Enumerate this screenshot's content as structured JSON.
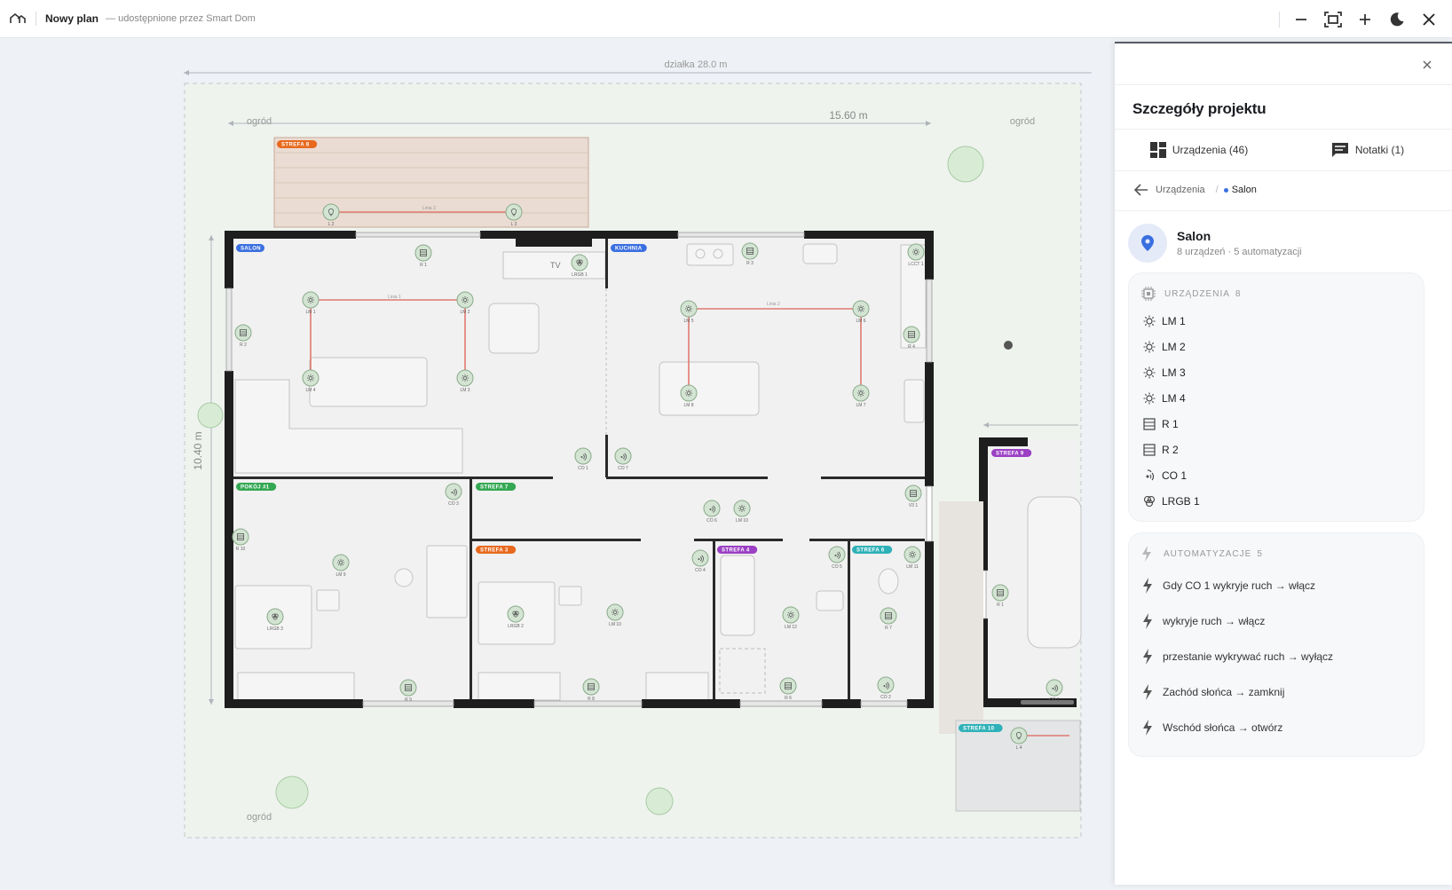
{
  "topbar": {
    "title": "Nowy plan",
    "subtitle": "— udostępnione przez Smart Dom"
  },
  "plan": {
    "plot_label": "działka 28.0 m",
    "width_label": "15.60 m",
    "height_label": "10.40 m",
    "garden_labels": [
      "ogród",
      "ogród",
      "ogród"
    ],
    "tv_label": "TV",
    "zones": [
      {
        "label": "STREFA 8",
        "color": "#e8691e"
      },
      {
        "label": "SALON",
        "color": "#3a6fe0"
      },
      {
        "label": "KUCHNIA",
        "color": "#3a6fe0"
      },
      {
        "label": "POKÓJ #1",
        "color": "#34a853"
      },
      {
        "label": "STREFA 7",
        "color": "#34a853"
      },
      {
        "label": "STREFA 3",
        "color": "#e8691e"
      },
      {
        "label": "STREFA 4",
        "color": "#9b3fc4"
      },
      {
        "label": "STREFA 6",
        "color": "#2eb1b8"
      },
      {
        "label": "STREFA 9",
        "color": "#9b3fc4"
      },
      {
        "label": "STREFA 10",
        "color": "#2eb1b8"
      }
    ],
    "devices": [
      {
        "id": "L 2",
        "icon": "bulb"
      },
      {
        "id": "L 3",
        "icon": "bulb"
      },
      {
        "id": "R 1",
        "icon": "shutter"
      },
      {
        "id": "LRGB 1",
        "icon": "rgb"
      },
      {
        "id": "LM 1",
        "icon": "light"
      },
      {
        "id": "LM 2",
        "icon": "light"
      },
      {
        "id": "LM 4",
        "icon": "light"
      },
      {
        "id": "LM 3",
        "icon": "light"
      },
      {
        "id": "R 2",
        "icon": "shutter"
      },
      {
        "id": "CO 1",
        "icon": "motion"
      },
      {
        "id": "CO 7",
        "icon": "motion"
      },
      {
        "id": "R 3",
        "icon": "shutter"
      },
      {
        "id": "LCCT 1",
        "icon": "light"
      },
      {
        "id": "LM 5",
        "icon": "light"
      },
      {
        "id": "LM 6",
        "icon": "light"
      },
      {
        "id": "LM 8",
        "icon": "light"
      },
      {
        "id": "LM 7",
        "icon": "light"
      },
      {
        "id": "R 4",
        "icon": "shutter"
      },
      {
        "id": "CO 3",
        "icon": "motion"
      },
      {
        "id": "R 10",
        "icon": "shutter"
      },
      {
        "id": "LM 9",
        "icon": "light"
      },
      {
        "id": "LRGB 3",
        "icon": "rgb"
      },
      {
        "id": "R 9",
        "icon": "shutter"
      },
      {
        "id": "CO 6",
        "icon": "motion"
      },
      {
        "id": "LM 10",
        "icon": "light"
      },
      {
        "id": "V3 1",
        "icon": "shutter"
      },
      {
        "id": "LRGB 2",
        "icon": "rgb"
      },
      {
        "id": "LM 10",
        "icon": "light"
      },
      {
        "id": "R 8",
        "icon": "shutter"
      },
      {
        "id": "CO 4",
        "icon": "motion"
      },
      {
        "id": "CO 5",
        "icon": "motion"
      },
      {
        "id": "LM 11",
        "icon": "light"
      },
      {
        "id": "LM 12",
        "icon": "light"
      },
      {
        "id": "R 7",
        "icon": "shutter"
      },
      {
        "id": "R 6",
        "icon": "shutter"
      },
      {
        "id": "CO 2",
        "icon": "motion"
      },
      {
        "id": "R 1",
        "icon": "shutter"
      },
      {
        "id": "CO 1",
        "icon": "motion"
      },
      {
        "id": "L 4",
        "icon": "bulb"
      }
    ],
    "line_labels": [
      "Linia 1",
      "Linia 2",
      "Linia 3"
    ]
  },
  "panel": {
    "title": "Szczegóły projektu",
    "tabs": [
      {
        "label": "Urządzenia (46)",
        "icon": "dashboard-icon"
      },
      {
        "label": "Notatki (1)",
        "icon": "comment-icon"
      }
    ],
    "breadcrumb": {
      "parent": "Urządzenia",
      "current": "Salon"
    },
    "room": {
      "name": "Salon",
      "meta": "8 urządzeń · 5 automatyzacji",
      "accent": "#3a6fe0"
    },
    "devices_section": {
      "title": "URZĄDZENIA",
      "count": "8",
      "items": [
        {
          "label": "LM 1",
          "icon": "light-icon"
        },
        {
          "label": "LM 2",
          "icon": "light-icon"
        },
        {
          "label": "LM 3",
          "icon": "light-icon"
        },
        {
          "label": "LM 4",
          "icon": "light-icon"
        },
        {
          "label": "R 1",
          "icon": "shutter-icon"
        },
        {
          "label": "R 2",
          "icon": "shutter-icon"
        },
        {
          "label": "CO 1",
          "icon": "motion-sensor-icon"
        },
        {
          "label": "LRGB 1",
          "icon": "rgb-light-icon"
        }
      ]
    },
    "automations_section": {
      "title": "AUTOMATYZACJE",
      "count": "5",
      "items": [
        {
          "label": "Gdy CO 1 wykryje ruch → włącz"
        },
        {
          "label": "wykryje ruch → włącz"
        },
        {
          "label": "przestanie wykrywać ruch → wyłącz"
        },
        {
          "label": "Zachód słońca → zamknij"
        },
        {
          "label": "Wschód słońca → otwórz"
        }
      ]
    }
  }
}
